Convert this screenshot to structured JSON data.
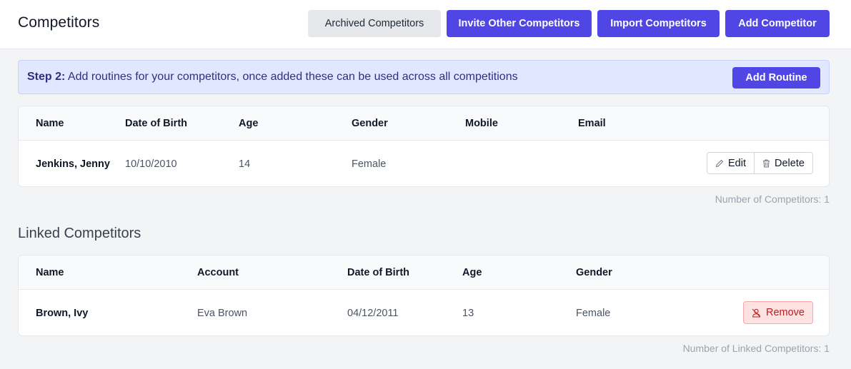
{
  "header": {
    "title": "Competitors",
    "archived_label": "Archived Competitors",
    "invite_label": "Invite Other Competitors",
    "import_label": "Import Competitors",
    "add_label": "Add Competitor"
  },
  "banner": {
    "step_label": "Step 2:",
    "message": "Add routines for your competitors, once added these can be used across all competitions",
    "add_routine_label": "Add Routine"
  },
  "competitors": {
    "columns": [
      "Name",
      "Date of Birth",
      "Age",
      "Gender",
      "Mobile",
      "Email"
    ],
    "rows": [
      {
        "name": "Jenkins, Jenny",
        "dob": "10/10/2010",
        "age": "14",
        "gender": "Female",
        "mobile": "",
        "email": "",
        "edit_label": "Edit",
        "delete_label": "Delete"
      }
    ],
    "count_text": "Number of Competitors: 1"
  },
  "linked": {
    "title": "Linked Competitors",
    "columns": [
      "Name",
      "Account",
      "Date of Birth",
      "Age",
      "Gender"
    ],
    "rows": [
      {
        "name": "Brown, Ivy",
        "account": "Eva Brown",
        "dob": "04/12/2011",
        "age": "13",
        "gender": "Female",
        "remove_label": "Remove"
      }
    ],
    "count_text": "Number of Linked Competitors: 1"
  },
  "icons": {
    "edit": "pencil-icon",
    "delete": "trash-icon",
    "remove": "user-remove-icon"
  },
  "colors": {
    "primary": "#4f46e5",
    "banner_bg": "#e0e7ff",
    "danger_bg": "#fee2e2",
    "danger_text": "#b91c1c"
  }
}
